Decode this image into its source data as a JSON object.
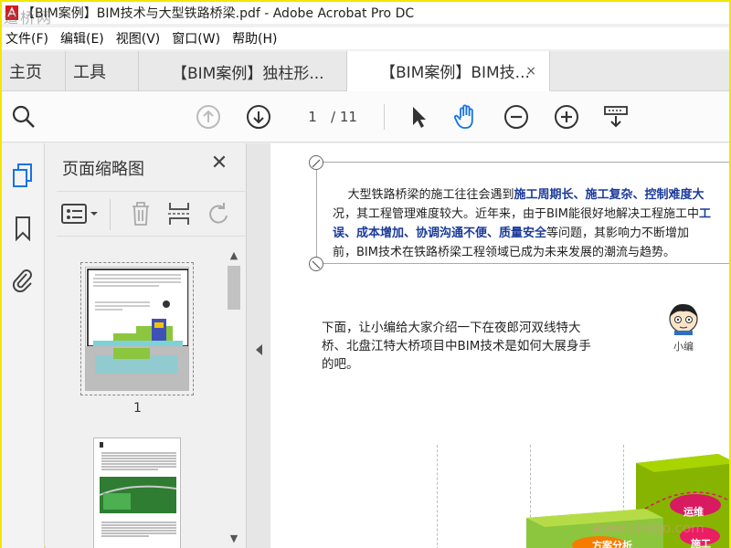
{
  "window": {
    "title": "【BIM案例】BIM技术与大型铁路桥梁.pdf - Adobe Acrobat Pro DC",
    "watermark_logo": "道桥网"
  },
  "menubar": {
    "items": [
      "文件(F)",
      "编辑(E)",
      "视图(V)",
      "窗口(W)",
      "帮助(H)"
    ]
  },
  "tabs": {
    "home": "主页",
    "tools": "工具",
    "doc1": "【BIM案例】独柱形...",
    "doc2": "【BIM案例】BIM技...",
    "close_glyph": "×"
  },
  "toolbar": {
    "current_page": "1",
    "total_pages": "/ 11",
    "icons": [
      "search-icon",
      "page-up-icon",
      "page-down-icon",
      "select-arrow-icon",
      "hand-icon",
      "zoom-out-icon",
      "zoom-in-icon",
      "keyboard-tools-icon"
    ]
  },
  "sidebar": {
    "panel_title": "页面缩略图",
    "close_glyph": "✕",
    "thumbnails": [
      {
        "label": "1"
      }
    ]
  },
  "document": {
    "quote_line1_a": "大型铁路桥梁的施工往往会遇到",
    "quote_line1_b": "施工周期长、施工复杂、控制难度大",
    "quote_line2_a": "况，其工程管理难度较大。近年来，由于BIM能很好地解决工程施工中",
    "quote_line2_b": "工",
    "quote_line3_a": "误、成本增加、协调沟通不便、质量安全",
    "quote_line3_b": "等问题，其影响力不断增加",
    "quote_line4": "前，BIM技术在铁路桥梁工程领域已成为未来发展的潮流与趋势。",
    "intro_lines": [
      "下面，让小编给大家介绍一下在夜郎河双线特大",
      "桥、北盘江特大桥项目中BIM技术是如何大展身手",
      "的吧。"
    ],
    "avatar_label": "小编",
    "diagram_labels": {
      "ops": "运维",
      "construction": "施工",
      "analysis": "方案分析"
    },
    "watermark": "www.cndqo.com"
  },
  "colors": {
    "highlight_blue": "#1b3a9a",
    "acrobat_blue": "#1473e6",
    "window_border": "#f2e600"
  }
}
